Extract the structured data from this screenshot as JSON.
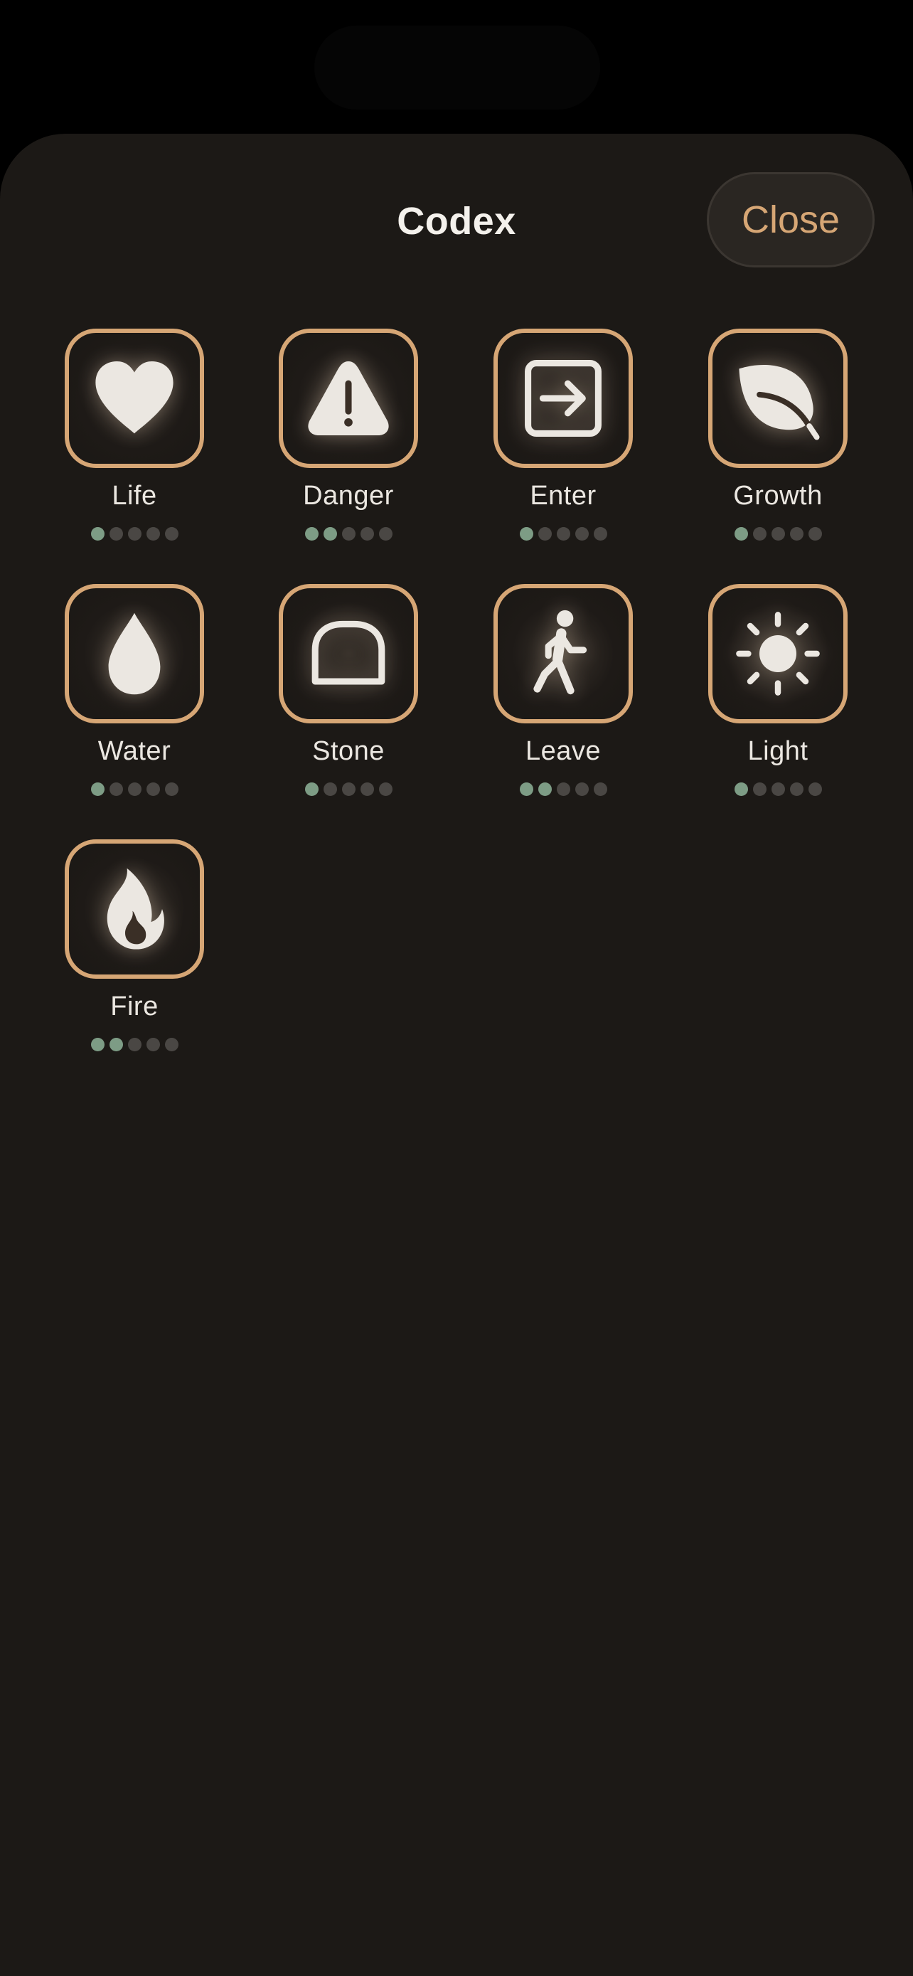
{
  "sheet": {
    "title": "Codex",
    "close_label": "Close"
  },
  "colors": {
    "background": "#1c1916",
    "accent": "#d6a675",
    "dot_on": "#7d9c85",
    "dot_off": "#4a4744",
    "icon": "#ebe7e1"
  },
  "items": [
    {
      "label": "Life",
      "icon": "heart-icon",
      "level": 1,
      "max": 5
    },
    {
      "label": "Danger",
      "icon": "warning-triangle-icon",
      "level": 2,
      "max": 5
    },
    {
      "label": "Enter",
      "icon": "enter-arrow-icon",
      "level": 1,
      "max": 5
    },
    {
      "label": "Growth",
      "icon": "leaf-icon",
      "level": 1,
      "max": 5
    },
    {
      "label": "Water",
      "icon": "water-drop-icon",
      "level": 1,
      "max": 5
    },
    {
      "label": "Stone",
      "icon": "stone-icon",
      "level": 1,
      "max": 5
    },
    {
      "label": "Leave",
      "icon": "walking-figure-icon",
      "level": 2,
      "max": 5
    },
    {
      "label": "Light",
      "icon": "sun-icon",
      "level": 1,
      "max": 5
    },
    {
      "label": "Fire",
      "icon": "flame-icon",
      "level": 2,
      "max": 5
    }
  ]
}
